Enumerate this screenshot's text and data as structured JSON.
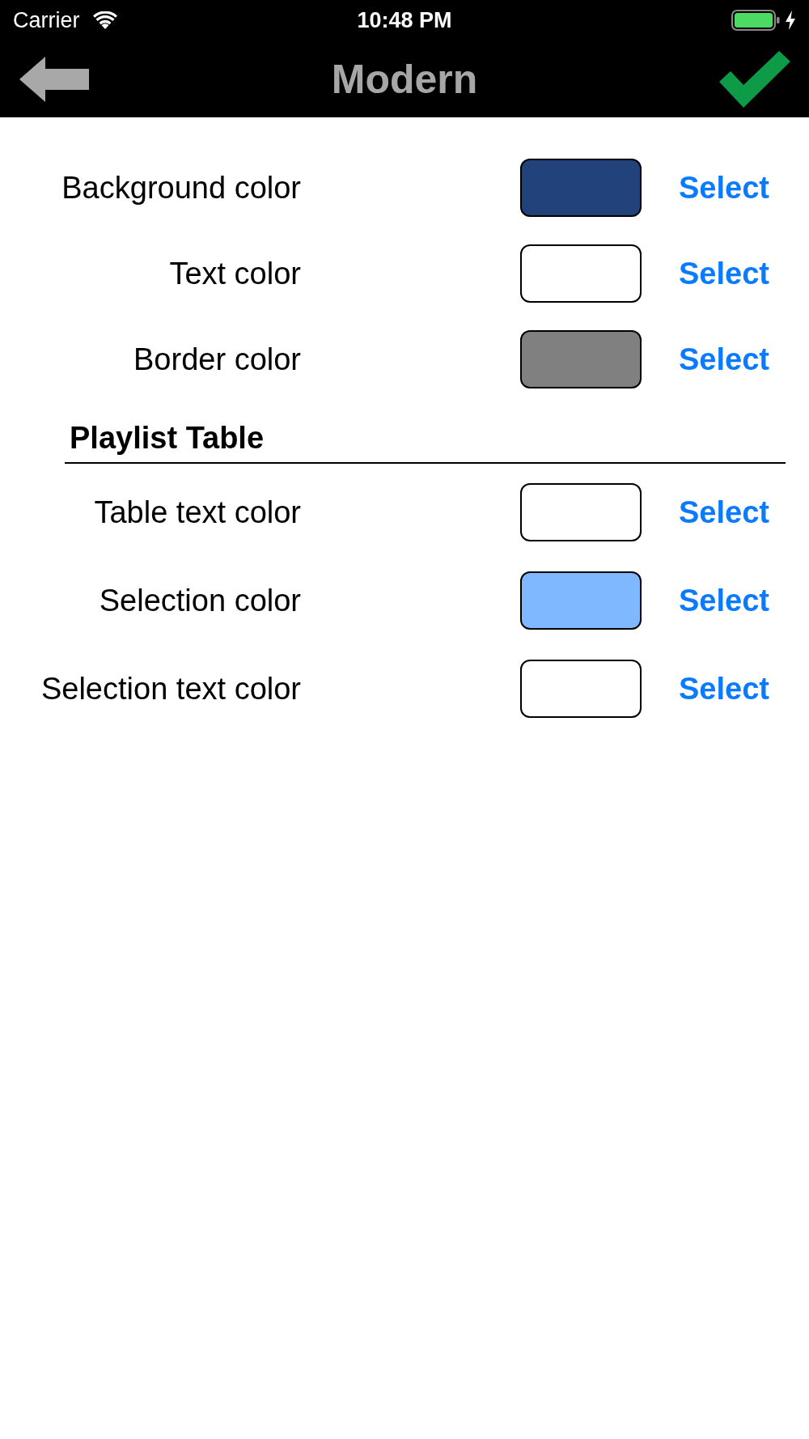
{
  "status_bar": {
    "carrier": "Carrier",
    "time": "10:48 PM"
  },
  "nav_bar": {
    "title": "Modern"
  },
  "groups": [
    {
      "rows": [
        {
          "label": "Background color",
          "color": "#21427a",
          "button": "Select"
        },
        {
          "label": "Text color",
          "color": "#ffffff",
          "button": "Select"
        },
        {
          "label": "Border color",
          "color": "#808080",
          "button": "Select"
        }
      ]
    },
    {
      "heading": "Playlist Table",
      "rows": [
        {
          "label": "Table text color",
          "color": "#ffffff",
          "button": "Select"
        },
        {
          "label": "Selection color",
          "color": "#7fb8ff",
          "button": "Select"
        },
        {
          "label": "Selection text color",
          "color": "#ffffff",
          "button": "Select"
        }
      ]
    }
  ]
}
